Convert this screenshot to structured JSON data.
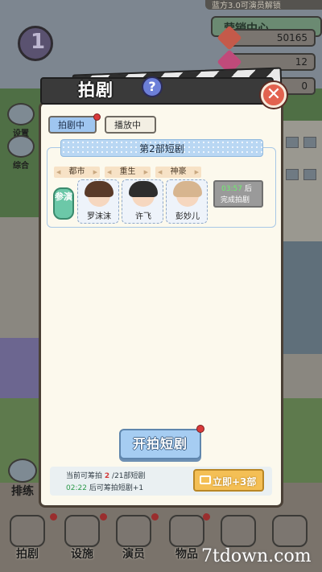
{
  "hud": {
    "top_notice": "蓝方3.0可演员解锁",
    "market_label": "营销中心",
    "resources": [
      {
        "name": "money",
        "value": "50165",
        "color": "#c45a4a",
        "icon": "cash-icon"
      },
      {
        "name": "gem",
        "value": "12",
        "color": "#c04a7a",
        "icon": "gem-icon"
      },
      {
        "name": "diamond",
        "value": "0",
        "color": "#4a6ac0",
        "icon": "diamond-icon"
      }
    ]
  },
  "side": {
    "badge_number": "1",
    "settings_label": "设置",
    "overview_label": "综合",
    "schedule_label": "排练"
  },
  "dialog": {
    "title": "拍剧",
    "help_symbol": "?",
    "close_symbol": "✕",
    "tabs": {
      "active": "拍剧中",
      "idle": "播放中"
    },
    "card": {
      "title": "第2部短剧",
      "join_label": "参演",
      "genres": [
        "都市",
        "重生",
        "神豪"
      ],
      "actors": [
        {
          "name": "罗沫沫",
          "hair_color": "#5a3a28"
        },
        {
          "name": "许飞",
          "hair_color": "#2d2d2d"
        },
        {
          "name": "彭妙儿",
          "hair_color": "#d7b58f"
        }
      ],
      "timer": {
        "time": "03:57",
        "suffix": "后",
        "status": "完成拍剧"
      }
    },
    "start_button": "开拍短剧",
    "info": {
      "line1_prefix": "当前可筹拍",
      "line1_count": "2",
      "line1_suffix": "/21部短剧",
      "line2_time": "02:22",
      "line2_suffix": "后可筹拍短剧+1"
    },
    "video_button": "立即+3部"
  },
  "nav": {
    "items": [
      {
        "label": "拍剧",
        "icon": "clapper-icon"
      },
      {
        "label": "设施",
        "icon": "facility-icon"
      },
      {
        "label": "演员",
        "icon": "actor-icon"
      },
      {
        "label": "物品",
        "icon": "item-icon"
      },
      {
        "label": "",
        "icon": "gift-icon"
      },
      {
        "label": "",
        "icon": "lock-icon"
      }
    ]
  },
  "watermark": "7tdown.com"
}
